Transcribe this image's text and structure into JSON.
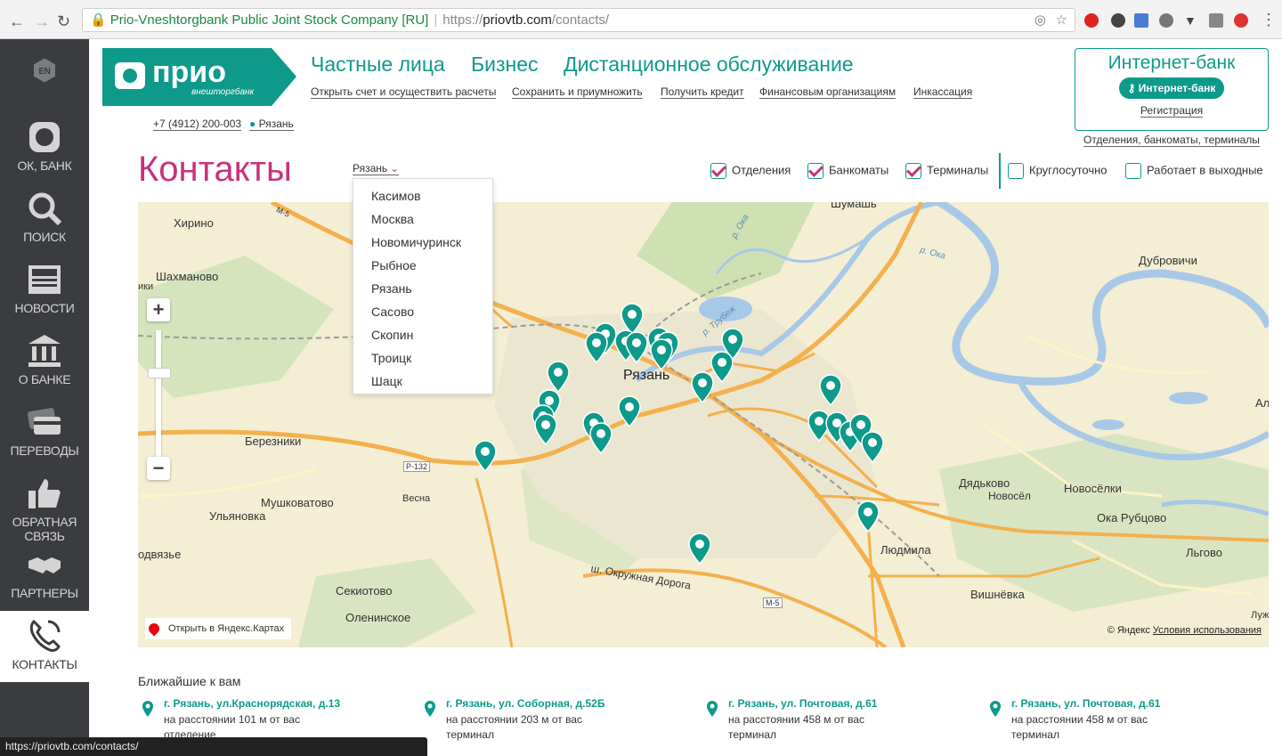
{
  "browser": {
    "cert_name": "Prio-Vneshtorgbank Public Joint Stock Company [RU]",
    "url_scheme": "https://",
    "url_host": "priovtb.com",
    "url_path": "/contacts/",
    "status_url": "https://priovtb.com/contacts/"
  },
  "sidebar": {
    "lang": "EN",
    "items": [
      {
        "label": "ОК, БАНК",
        "icon": "chat-bubble-icon"
      },
      {
        "label": "ПОИСК",
        "icon": "search-icon"
      },
      {
        "label": "НОВОСТИ",
        "icon": "news-icon"
      },
      {
        "label": "О БАНКЕ",
        "icon": "bank-building-icon"
      },
      {
        "label": "ПЕРЕВОДЫ",
        "icon": "cards-icon"
      },
      {
        "label": "ОБРАТНАЯ СВЯЗЬ",
        "icon": "thumbs-up-icon"
      },
      {
        "label": "ПАРТНЕРЫ",
        "icon": "handshake-icon"
      },
      {
        "label": "КОНТАКТЫ",
        "icon": "phone-icon"
      }
    ]
  },
  "header": {
    "logo_main": "прио",
    "logo_sub": "внешторгбанк",
    "nav": [
      "Частные лица",
      "Бизнес",
      "Дистанционное обслуживание"
    ],
    "subnav": [
      "Открыть счет и осуществить расчеты",
      "Сохранить и приумножить",
      "Получить кредит",
      "Финансовым организациям",
      "Инкассация"
    ],
    "phone": "+7 (4912) 200-003",
    "city": "Рязань",
    "internet_bank_title": "Интернет-банк",
    "internet_bank_button": "Интернет-банк",
    "registration": "Регистрация",
    "branches_link": "Отделения, банкоматы, терминалы"
  },
  "page": {
    "title": "Контакты",
    "city_select": "Рязань"
  },
  "filters": [
    {
      "label": "Отделения",
      "checked": true
    },
    {
      "label": "Банкоматы",
      "checked": true
    },
    {
      "label": "Терминалы",
      "checked": true
    },
    {
      "label": "Круглосуточно",
      "checked": false
    },
    {
      "label": "Работает в выходные",
      "checked": false
    }
  ],
  "city_dropdown": [
    "Касимов",
    "Москва",
    "Новомичуринск",
    "Рыбное",
    "Рязань",
    "Сасово",
    "Скопин",
    "Троицк",
    "Шацк"
  ],
  "map": {
    "labels": {
      "center": "Рязань",
      "l1": "Хирино",
      "l2": "Шахманово",
      "l3": "Березники",
      "l4": "Мушковатово",
      "l5": "Ульяновка",
      "l6": "Весна",
      "l7": "Секиотово",
      "l8": "Оленинское",
      "l9": "Шумашь",
      "l10": "Дубровичи",
      "l11": "Дядьково",
      "l12": "Новосёл",
      "l13": "Новосёлки",
      "l14": "Ока Рубцово",
      "l15": "Людмила",
      "l16": "Вишнёвка",
      "l17": "Льгово",
      "l18": "Ал",
      "l19": "Луж",
      "l20": "одвязье",
      "l21": "ики",
      "road1": "ш. Окружная Дорога",
      "road2": "М-5",
      "road3": "Р-132",
      "river1": "р. Ока",
      "river2": "р. Трубеж",
      "river3": "р. Ока"
    },
    "open_in_yandex": "Открыть в Яндекс.Картах",
    "copyright": "© Яндекс",
    "terms": "Условия использования",
    "zoom_in": "+",
    "zoom_out": "−"
  },
  "nearest": {
    "title": "Ближайшие к вам",
    "items": [
      {
        "address": "г. Рязань, ул.Краснорядская, д.13",
        "distance": "на расстоянии 101 м от вас",
        "type": "отделение"
      },
      {
        "address": "г. Рязань, ул. Соборная, д.52Б",
        "distance": "на расстоянии 203 м от вас",
        "type": "терминал"
      },
      {
        "address": "г. Рязань, ул. Почтовая, д.61",
        "distance": "на расстоянии 458 м от вас",
        "type": "терминал"
      },
      {
        "address": "г. Рязань, ул. Почтовая, д.61",
        "distance": "на расстоянии 458 м от вас",
        "type": "терминал"
      }
    ]
  },
  "colors": {
    "brand": "#0d9a8a",
    "accent": "#c9317a",
    "sidebar": "#3a3c3f"
  }
}
